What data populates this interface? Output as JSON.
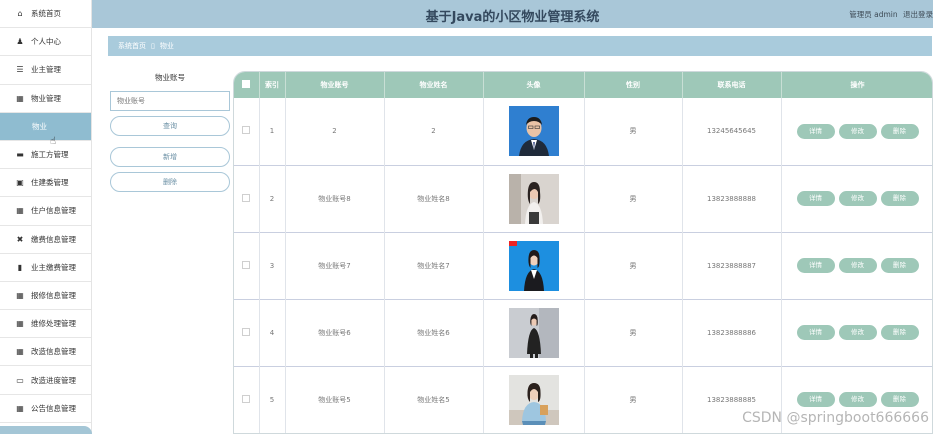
{
  "header": {
    "title": "基于Java的小区物业管理系统",
    "user_role": "管理员 admin",
    "logout": "退出登录"
  },
  "sidebar": {
    "items": [
      {
        "label": "系统首页",
        "icon": "home-icon",
        "glyph": "⌂"
      },
      {
        "label": "个人中心",
        "icon": "user-icon",
        "glyph": "♟"
      },
      {
        "label": "业主管理",
        "icon": "list-icon",
        "glyph": "☰"
      },
      {
        "label": "物业管理",
        "icon": "grid-icon",
        "glyph": "▦"
      },
      {
        "label": "物业",
        "icon": "",
        "glyph": "",
        "sub": true
      },
      {
        "label": "施工方管理",
        "icon": "chat-icon",
        "glyph": "▬"
      },
      {
        "label": "住建委管理",
        "icon": "clipboard-icon",
        "glyph": "▣"
      },
      {
        "label": "住户信息管理",
        "icon": "grid-icon",
        "glyph": "▦"
      },
      {
        "label": "缴费信息管理",
        "icon": "ticket-icon",
        "glyph": "✖"
      },
      {
        "label": "业主缴费管理",
        "icon": "bar-chart-icon",
        "glyph": "▮"
      },
      {
        "label": "报修信息管理",
        "icon": "grid-icon",
        "glyph": "▦"
      },
      {
        "label": "维修处理管理",
        "icon": "grid-icon",
        "glyph": "▦"
      },
      {
        "label": "改造信息管理",
        "icon": "grid-icon",
        "glyph": "▦"
      },
      {
        "label": "改造进度管理",
        "icon": "monitor-icon",
        "glyph": "▭"
      },
      {
        "label": "公告信息管理",
        "icon": "table-icon",
        "glyph": "▦"
      }
    ]
  },
  "breadcrumb": {
    "home": "系统首页",
    "separator": "▯",
    "current": "物业"
  },
  "search": {
    "label": "物业账号",
    "placeholder": "物业账号",
    "search_btn": "查询",
    "add_btn": "新增",
    "delete_btn": "删除"
  },
  "table": {
    "columns": [
      "索引",
      "物业账号",
      "物业姓名",
      "头像",
      "性别",
      "联系电话",
      "操作"
    ],
    "rows": [
      {
        "index": "1",
        "account": "2",
        "name": "2",
        "gender": "男",
        "phone": "13245645645"
      },
      {
        "index": "2",
        "account": "物业账号8",
        "name": "物业姓名8",
        "gender": "男",
        "phone": "13823888888"
      },
      {
        "index": "3",
        "account": "物业账号7",
        "name": "物业姓名7",
        "gender": "男",
        "phone": "13823888887"
      },
      {
        "index": "4",
        "account": "物业账号6",
        "name": "物业姓名6",
        "gender": "男",
        "phone": "13823888886"
      },
      {
        "index": "5",
        "account": "物业账号5",
        "name": "物业姓名5",
        "gender": "男",
        "phone": "13823888885"
      }
    ],
    "actions": {
      "detail": "详情",
      "edit": "修改",
      "delete": "删除"
    }
  },
  "watermark": "CSDN @springboot666666",
  "colors": {
    "header_bg": "#a9c7d8",
    "table_header_bg": "#9ec8b8",
    "active_menu_bg": "#8fbcd0",
    "action_btn_bg": "#9ec8b8"
  }
}
